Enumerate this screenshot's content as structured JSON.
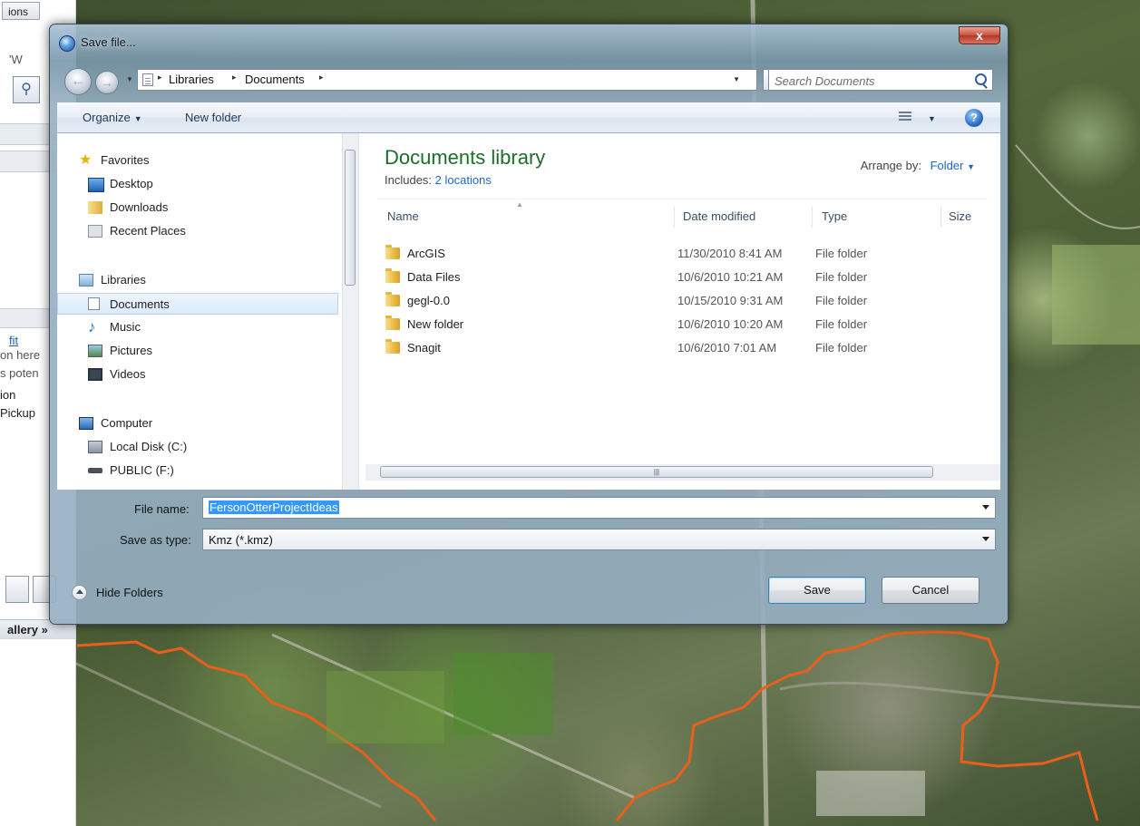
{
  "background_app": {
    "tab_label": "ions",
    "lines": [
      "'W",
      "fit",
      "on here",
      "s poten",
      "ion",
      "Pickup"
    ],
    "gallery_label": "allery »"
  },
  "dialog": {
    "title": "Save file...",
    "close_symbol": "x",
    "address": {
      "crumbs": [
        "Libraries",
        "Documents"
      ],
      "separator": "▸"
    },
    "search_placeholder": "Search Documents",
    "toolbar": {
      "organize": "Organize",
      "new_folder": "New folder"
    },
    "nav": {
      "favorites_header": "Favorites",
      "favorites": [
        "Desktop",
        "Downloads",
        "Recent Places"
      ],
      "libraries_header": "Libraries",
      "libraries": [
        "Documents",
        "Music",
        "Pictures",
        "Videos"
      ],
      "computer_header": "Computer",
      "computer": [
        "Local Disk (C:)",
        "PUBLIC (F:)"
      ],
      "selected": "Documents"
    },
    "library": {
      "title": "Documents library",
      "includes_label": "Includes:",
      "includes_link": "2 locations",
      "arrange_label": "Arrange by:",
      "arrange_value": "Folder"
    },
    "columns": [
      "Name",
      "Date modified",
      "Type",
      "Size"
    ],
    "files": [
      {
        "name": "ArcGIS",
        "date": "11/30/2010 8:41 AM",
        "type": "File folder"
      },
      {
        "name": "Data Files",
        "date": "10/6/2010 10:21 AM",
        "type": "File folder"
      },
      {
        "name": "gegl-0.0",
        "date": "10/15/2010 9:31 AM",
        "type": "File folder"
      },
      {
        "name": "New folder",
        "date": "10/6/2010 10:20 AM",
        "type": "File folder"
      },
      {
        "name": "Snagit",
        "date": "10/6/2010 7:01 AM",
        "type": "File folder"
      }
    ],
    "file_name_label": "File name:",
    "file_name_value": "FersonOtterProjectIdeas",
    "save_type_label": "Save as type:",
    "save_type_value": "Kmz (*.kmz)",
    "hide_folders": "Hide Folders",
    "save_button": "Save",
    "cancel_button": "Cancel"
  },
  "colors": {
    "library_title": "#1e6e2a",
    "link": "#1e66c4",
    "selection": "#3399ff",
    "boundary_line": "#e8601c"
  }
}
